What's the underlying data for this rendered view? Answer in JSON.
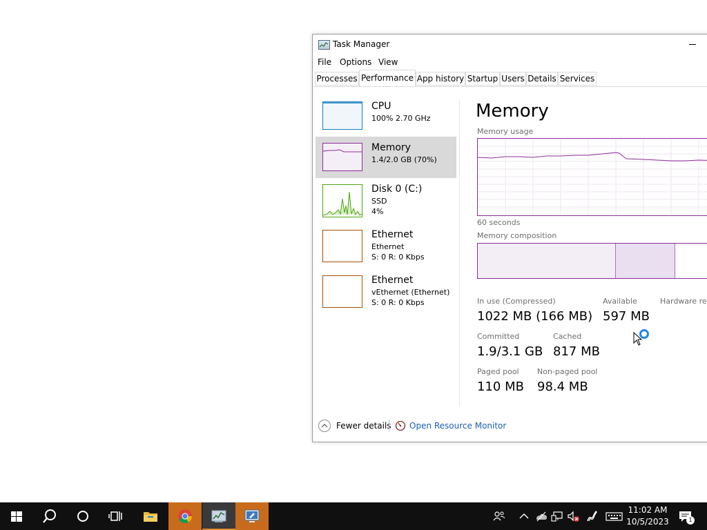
{
  "window": {
    "title": "Task Manager",
    "menu": [
      "File",
      "Options",
      "View"
    ],
    "tabs": [
      "Processes",
      "Performance",
      "App history",
      "Startup",
      "Users",
      "Details",
      "Services"
    ],
    "active_tab": "Performance"
  },
  "sidebar": [
    {
      "title": "CPU",
      "line1": "100% 2.70 GHz",
      "line2": "",
      "line3": ""
    },
    {
      "title": "Memory",
      "line1": "1.4/2.0 GB (70%)",
      "line2": "",
      "line3": ""
    },
    {
      "title": "Disk 0 (C:)",
      "line1": "SSD",
      "line2": "4%",
      "line3": ""
    },
    {
      "title": "Ethernet",
      "line1": "Ethernet",
      "line2": "S: 0 R: 0 Kbps",
      "line3": ""
    },
    {
      "title": "Ethernet",
      "line1": "vEthernet (Ethernet)",
      "line2": "S: 0 R: 0 Kbps",
      "line3": ""
    }
  ],
  "detail": {
    "heading": "Memory",
    "usage_caption": "Memory usage",
    "time_caption": "60 seconds",
    "composition_caption": "Memory composition",
    "composition": {
      "in_use_fraction": 0.56,
      "cached_fraction": 0.24
    },
    "stats": {
      "in_use_label": "In use (Compressed)",
      "in_use_value": "1022 MB (166 MB)",
      "available_label": "Available",
      "available_value": "597 MB",
      "hardware_label": "Hardware res",
      "committed_label": "Committed",
      "committed_value": "1.9/3.1 GB",
      "cached_label": "Cached",
      "cached_value": "817 MB",
      "paged_label": "Paged pool",
      "paged_value": "110 MB",
      "nonpaged_label": "Non-paged pool",
      "nonpaged_value": "98.4 MB"
    }
  },
  "footer": {
    "fewer_details": "Fewer details",
    "resource_monitor": "Open Resource Monitor"
  },
  "taskbar": {
    "time": "11:02 AM",
    "date": "10/5/2023",
    "notification_count": "1"
  },
  "colors": {
    "memory_accent": "#8b2c99",
    "cpu_accent": "#117dbb",
    "disk_accent": "#4da60c",
    "ethernet_accent": "#a74f01",
    "link": "#1a5fb4"
  }
}
